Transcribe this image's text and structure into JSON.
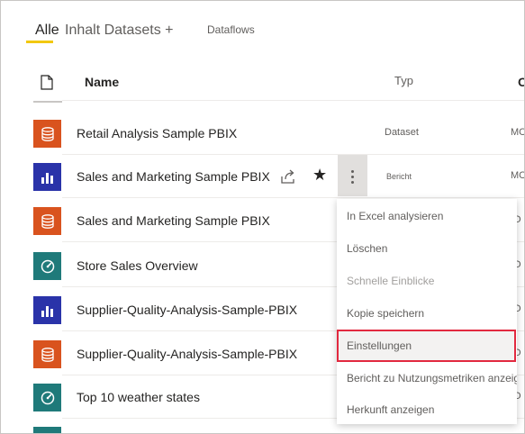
{
  "tabs": {
    "alle": "Alle",
    "inhalt": "Inhalt",
    "datasets": "Datasets +",
    "dataflows": "Dataflows"
  },
  "columns": {
    "name": "Name",
    "type": "Typ",
    "owner": "O"
  },
  "rows": [
    {
      "name": "Retail Analysis Sample PBIX",
      "type": "Dataset",
      "owner": "MC",
      "icon": "dataset-icon",
      "color": "#d9531e"
    },
    {
      "name": "Sales and Marketing Sample PBIX",
      "type": "Bericht",
      "owner": "MC",
      "icon": "report-icon",
      "color": "#2a33a9"
    },
    {
      "name": "Sales and Marketing Sample PBIX",
      "type": "",
      "owner": "IO",
      "icon": "dataset-icon",
      "color": "#d9531e"
    },
    {
      "name": "Store Sales Overview",
      "type": "",
      "owner": "IO",
      "icon": "dashboard-icon",
      "color": "#1f7a7a"
    },
    {
      "name": "Supplier-Quality-Analysis-Sample-PBIX",
      "type": "",
      "owner": "IO",
      "icon": "report-icon",
      "color": "#2a33a9"
    },
    {
      "name": "Supplier-Quality-Analysis-Sample-PBIX",
      "type": "",
      "owner": "IO",
      "icon": "dataset-icon",
      "color": "#d9531e"
    },
    {
      "name": "Top 10 weather states",
      "type": "",
      "owner": "IO",
      "icon": "dashboard-icon",
      "color": "#1f7a7a"
    }
  ],
  "menu": [
    {
      "label": "In Excel analysieren",
      "state": "enabled"
    },
    {
      "label": "Löschen",
      "state": "enabled"
    },
    {
      "label": "Schnelle Einblicke",
      "state": "disabled"
    },
    {
      "label": "Kopie speichern",
      "state": "enabled"
    },
    {
      "label": "Einstellungen",
      "state": "highlighted"
    },
    {
      "label": "Bericht zu Nutzungsmetriken anzeigen",
      "state": "enabled"
    },
    {
      "label": "Herkunft anzeigen",
      "state": "enabled"
    }
  ],
  "colors": {
    "accent": "#f2c811",
    "highlight_border": "#e2293f"
  }
}
